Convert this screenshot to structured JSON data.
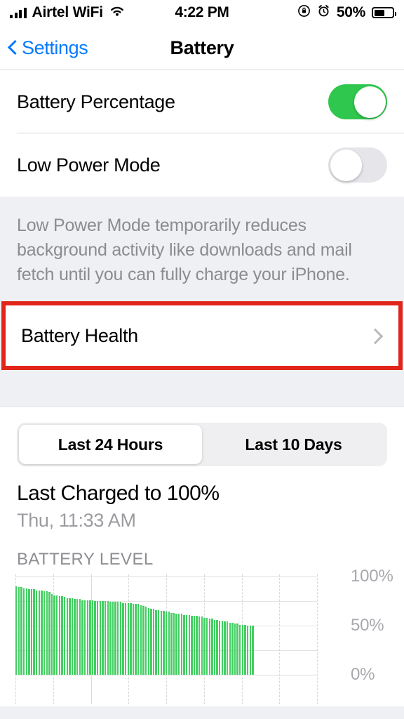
{
  "status_bar": {
    "carrier": "Airtel WiFi",
    "wifi_icon": "wifi-icon",
    "signal_icon": "cellular-signal-icon",
    "time": "4:22 PM",
    "rotation_lock_icon": "rotation-lock-icon",
    "alarm_icon": "alarm-clock-icon",
    "battery_percent": "50%",
    "battery_fill": 50
  },
  "nav": {
    "back_label": "Settings",
    "back_icon": "chevron-left-icon",
    "title": "Battery"
  },
  "settings": {
    "rows": [
      {
        "label": "Battery Percentage",
        "toggle": "on"
      },
      {
        "label": "Low Power Mode",
        "toggle": "off"
      }
    ],
    "footer_note": "Low Power Mode temporarily reduces background activity like downloads and mail fetch until you can fully charge your iPhone."
  },
  "battery_health": {
    "label": "Battery Health",
    "chevron_icon": "chevron-right-icon",
    "highlight_color": "#e1251b",
    "highlighted": true
  },
  "usage": {
    "segments": [
      {
        "label": "Last 24 Hours",
        "selected": true
      },
      {
        "label": "Last 10 Days",
        "selected": false
      }
    ],
    "last_charged_title": "Last Charged to 100%",
    "last_charged_time": "Thu, 11:33 AM",
    "chart_heading": "BATTERY LEVEL"
  },
  "colors": {
    "toggle_on": "#30c74e",
    "toggle_off": "#e6e6ea",
    "accent_blue": "#067aff",
    "bar_green": "#44cf62",
    "group_background": "#eff0f3"
  },
  "chart_data": {
    "type": "bar",
    "title": "BATTERY LEVEL",
    "xlabel": "",
    "ylabel": "",
    "ylim": [
      0,
      100
    ],
    "ytick_labels": [
      "100%",
      "50%",
      "0%"
    ],
    "yticks": [
      100,
      50,
      0
    ],
    "gridlines": [
      100,
      75,
      50,
      25,
      0
    ],
    "grid": true,
    "legend": "none",
    "series_name": "Battery level",
    "bar_color": "#44cf62",
    "values": [
      90,
      89,
      89,
      88,
      88,
      87,
      87,
      87,
      86,
      86,
      86,
      85,
      85,
      84,
      82,
      81,
      81,
      80,
      80,
      79,
      78,
      78,
      78,
      77,
      77,
      77,
      76,
      76,
      76,
      76,
      76,
      75,
      75,
      75,
      75,
      75,
      75,
      74,
      74,
      74,
      74,
      74,
      73,
      73,
      73,
      73,
      72,
      72,
      72,
      71,
      70,
      69,
      68,
      67,
      67,
      66,
      66,
      65,
      65,
      64,
      64,
      63,
      63,
      62,
      62,
      62,
      61,
      61,
      61,
      60,
      60,
      60,
      59,
      59,
      58,
      58,
      57,
      57,
      56,
      56,
      55,
      55,
      54,
      54,
      53,
      53,
      52,
      52,
      51,
      51,
      51,
      50,
      50,
      50
    ]
  }
}
